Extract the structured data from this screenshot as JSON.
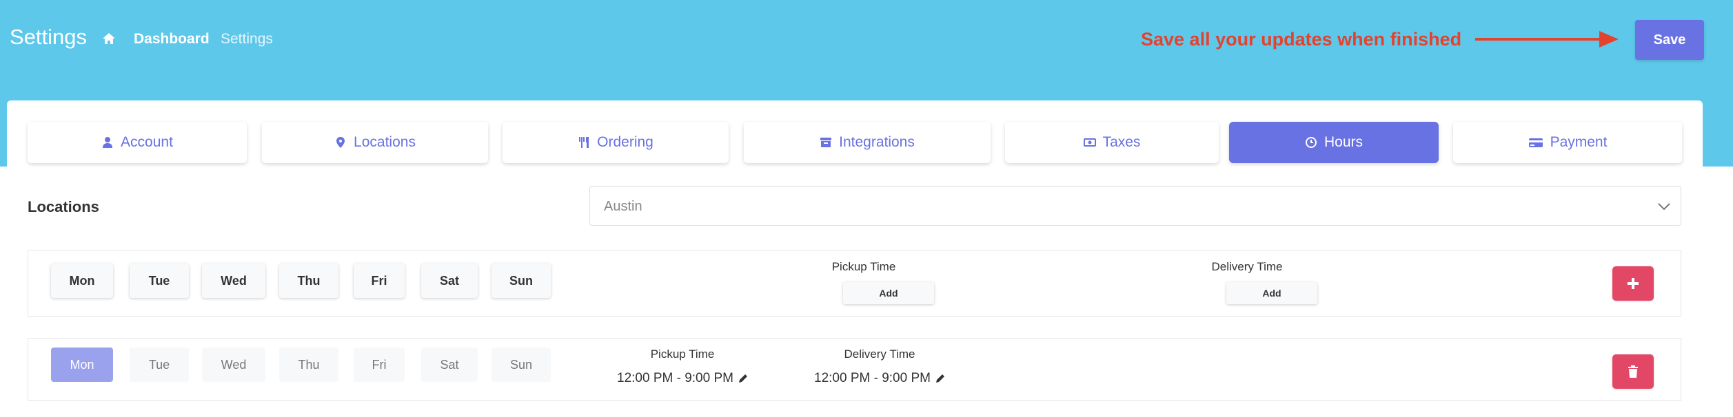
{
  "header": {
    "title": "Settings",
    "breadcrumb": [
      "Dashboard",
      "Settings"
    ],
    "annotation": "Save all your updates when finished",
    "save_label": "Save"
  },
  "tabs": [
    {
      "label": "Account",
      "icon": "user-icon"
    },
    {
      "label": "Locations",
      "icon": "map-pin-icon"
    },
    {
      "label": "Ordering",
      "icon": "utensils-icon"
    },
    {
      "label": "Integrations",
      "icon": "archive-icon"
    },
    {
      "label": "Taxes",
      "icon": "money-icon"
    },
    {
      "label": "Hours",
      "icon": "clock-icon",
      "active": true
    },
    {
      "label": "Payment",
      "icon": "credit-card-icon"
    }
  ],
  "locations": {
    "label": "Locations",
    "selected": "Austin"
  },
  "days": [
    "Mon",
    "Tue",
    "Wed",
    "Thu",
    "Fri",
    "Sat",
    "Sun"
  ],
  "new_hours": {
    "pickup_title": "Pickup Time",
    "delivery_title": "Delivery Time",
    "pickup_add": "Add",
    "delivery_add": "Add"
  },
  "existing_hours": [
    {
      "selected_day": "Mon",
      "pickup_title": "Pickup Time",
      "pickup_value": "12:00 PM - 9:00 PM",
      "delivery_title": "Delivery Time",
      "delivery_value": "12:00 PM - 9:00 PM"
    }
  ],
  "colors": {
    "header_bg": "#5ec8eb",
    "accent": "#6872e2",
    "danger": "#e24866",
    "annotation": "#e3432e"
  }
}
